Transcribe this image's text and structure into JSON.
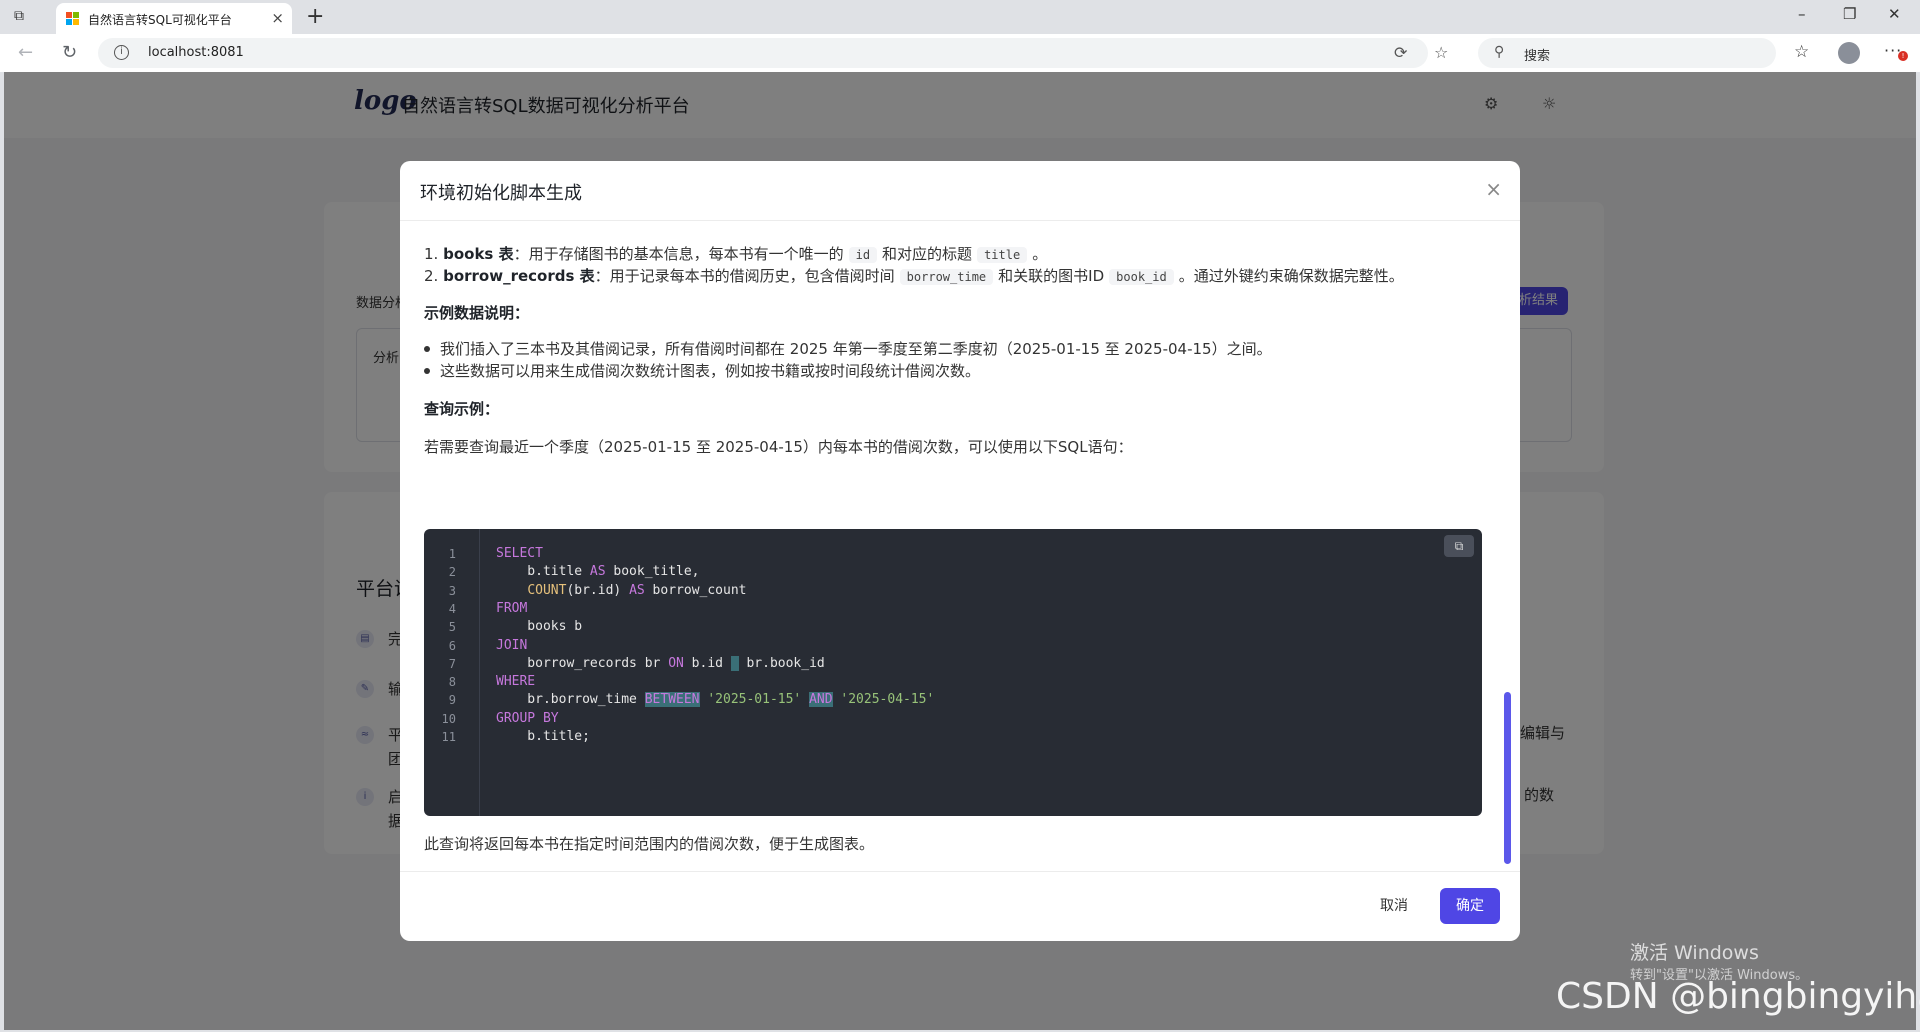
{
  "browser": {
    "tab_title": "自然语言转SQL可视化平台",
    "tab_close": "×",
    "new_tab": "+",
    "window_controls": {
      "minimize": "–",
      "restore": "❐",
      "close": "✕"
    },
    "url": "localhost:8081",
    "search_placeholder": "搜索",
    "more": "···",
    "more_badge": "!"
  },
  "app": {
    "logo_text": "logo",
    "title": "自然语言转SQL数据可视化分析平台",
    "behind": {
      "analysis_label": "数据分析",
      "input_label": "分析",
      "result_button": "析结果",
      "section_title": "平台说",
      "features": [
        {
          "icon": "table-icon",
          "text": "完"
        },
        {
          "icon": "wrench-icon",
          "text": "输"
        },
        {
          "icon": "chart-icon",
          "text": "平",
          "text2": "团"
        },
        {
          "icon": "info-icon",
          "text": "启",
          "text2": "据"
        }
      ],
      "right_text_1": "编辑与",
      "right_text_2": "的数"
    }
  },
  "modal": {
    "title": "环境初始化脚本生成",
    "close": "×",
    "table_desc": [
      {
        "num": "1.",
        "name": "books 表",
        "text_a": "：用于存储图书的基本信息，每本书有一个唯一的",
        "code_a": "id",
        "text_b": "和对应的标题",
        "code_b": "title",
        "text_c": "。"
      },
      {
        "num": "2.",
        "name": "borrow_records 表",
        "text_a": "：用于记录每本书的借阅历史，包含借阅时间",
        "code_a": "borrow_time",
        "text_b": "和关联的图书ID",
        "code_b": "book_id",
        "text_c": "。通过外键约束确保数据完整性。"
      }
    ],
    "sample_heading": "示例数据说明：",
    "sample_bullets": [
      "我们插入了三本书及其借阅记录，所有借阅时间都在 2025 年第一季度至第二季度初（2025-01-15 至 2025-04-15）之间。",
      "这些数据可以用来生成借阅次数统计图表，例如按书籍或按时间段统计借阅次数。"
    ],
    "query_heading": "查询示例：",
    "query_intro": "若需要查询最近一个季度（2025-01-15 至 2025-04-15）内每本书的借阅次数，可以使用以下SQL语句：",
    "code_lines": [
      {
        "n": "1",
        "parts": [
          {
            "t": "SELECT",
            "c": "kw"
          }
        ]
      },
      {
        "n": "2",
        "parts": [
          {
            "t": "    b.title ",
            "c": ""
          },
          {
            "t": "AS",
            "c": "kw"
          },
          {
            "t": " book_title,",
            "c": ""
          }
        ]
      },
      {
        "n": "3",
        "parts": [
          {
            "t": "    ",
            "c": ""
          },
          {
            "t": "COUNT",
            "c": "fn"
          },
          {
            "t": "(br.id) ",
            "c": ""
          },
          {
            "t": "AS",
            "c": "kw"
          },
          {
            "t": " borrow_count",
            "c": ""
          }
        ]
      },
      {
        "n": "4",
        "parts": [
          {
            "t": "FROM",
            "c": "kw"
          }
        ]
      },
      {
        "n": "5",
        "parts": [
          {
            "t": "    books b",
            "c": ""
          }
        ]
      },
      {
        "n": "6",
        "parts": [
          {
            "t": "JOIN",
            "c": "kw"
          }
        ]
      },
      {
        "n": "7",
        "parts": [
          {
            "t": "    borrow_records br ",
            "c": ""
          },
          {
            "t": "ON",
            "c": "kw"
          },
          {
            "t": " b.id ",
            "c": ""
          },
          {
            "t": " ",
            "c": "sel"
          },
          {
            "t": " br.book_id",
            "c": ""
          }
        ]
      },
      {
        "n": "8",
        "parts": [
          {
            "t": "WHERE",
            "c": "kw"
          }
        ]
      },
      {
        "n": "9",
        "parts": [
          {
            "t": "    br.borrow_time ",
            "c": ""
          },
          {
            "t": "BETWEEN",
            "c": "sel"
          },
          {
            "t": " ",
            "c": ""
          },
          {
            "t": "'2025-01-15'",
            "c": "str"
          },
          {
            "t": " ",
            "c": ""
          },
          {
            "t": "AND",
            "c": "sel"
          },
          {
            "t": " ",
            "c": ""
          },
          {
            "t": "'2025-04-15'",
            "c": "str"
          }
        ]
      },
      {
        "n": "10",
        "parts": [
          {
            "t": "GROUP BY",
            "c": "kw"
          }
        ]
      },
      {
        "n": "11",
        "parts": [
          {
            "t": "    b.title;",
            "c": ""
          }
        ]
      }
    ],
    "copy_label": "⧉",
    "result_note": "此查询将返回每本书在指定时间范围内的借阅次数，便于生成图表。",
    "cancel_label": "取消",
    "ok_label": "确定"
  },
  "os": {
    "activate_title": "激活 Windows",
    "activate_sub": "转到\"设置\"以激活 Windows。",
    "watermark": "CSDN @bingbingyihao"
  }
}
